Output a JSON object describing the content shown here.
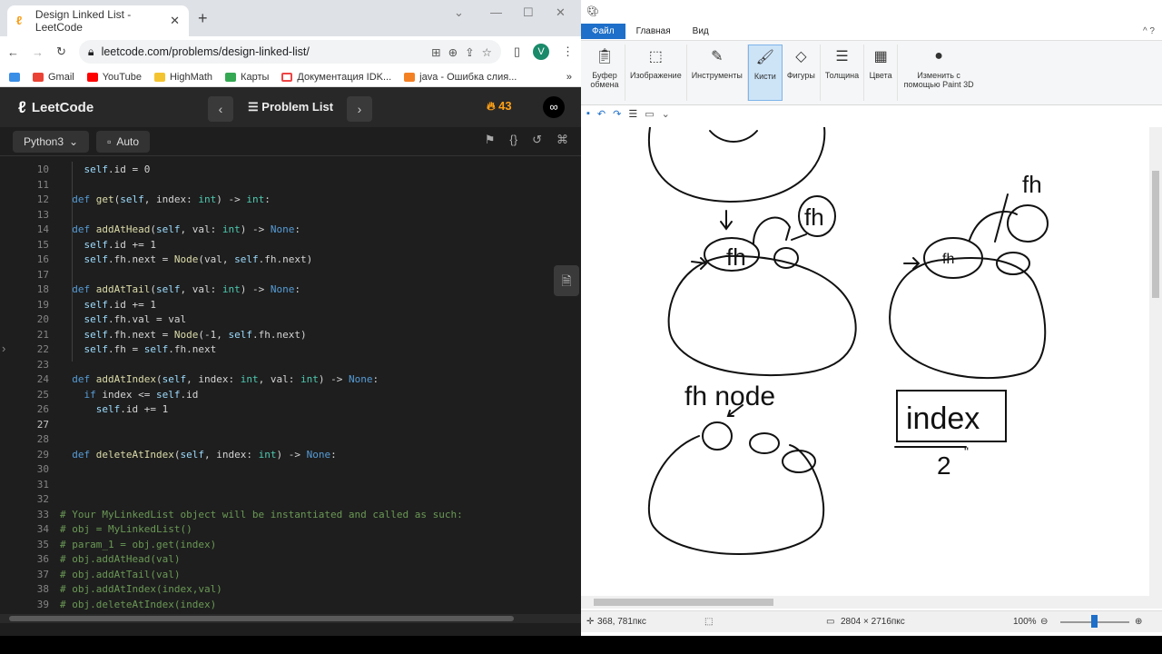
{
  "browser": {
    "tab_title": "Design Linked List - LeetCode",
    "url": "leetcode.com/problems/design-linked-list/",
    "profile_initial": "V",
    "bookmarks": [
      "Gmail",
      "YouTube",
      "HighMath",
      "Карты",
      "Документация IDK...",
      "java - Ошибка слия..."
    ]
  },
  "leetcode": {
    "logo": "LeetCode",
    "problem_list": "Problem List",
    "streak": "43",
    "language": "Python3",
    "mode": "Auto"
  },
  "code_lines": [
    {
      "n": "10",
      "text": "    self.id = 0"
    },
    {
      "n": "11",
      "text": ""
    },
    {
      "n": "12",
      "text": "  def get(self, index: int) -> int:"
    },
    {
      "n": "13",
      "text": ""
    },
    {
      "n": "14",
      "text": "  def addAtHead(self, val: int) -> None:"
    },
    {
      "n": "15",
      "text": "    self.id += 1"
    },
    {
      "n": "16",
      "text": "    self.fh.next = Node(val, self.fh.next)"
    },
    {
      "n": "17",
      "text": ""
    },
    {
      "n": "18",
      "text": "  def addAtTail(self, val: int) -> None:"
    },
    {
      "n": "19",
      "text": "    self.id += 1"
    },
    {
      "n": "20",
      "text": "    self.fh.val = val"
    },
    {
      "n": "21",
      "text": "    self.fh.next = Node(-1, self.fh.next)"
    },
    {
      "n": "22",
      "text": "    self.fh = self.fh.next"
    },
    {
      "n": "23",
      "text": ""
    },
    {
      "n": "24",
      "text": "  def addAtIndex(self, index: int, val: int) -> None:"
    },
    {
      "n": "25",
      "text": "    if index <= self.id"
    },
    {
      "n": "26",
      "text": "      self.id += 1"
    },
    {
      "n": "27",
      "text": ""
    },
    {
      "n": "28",
      "text": ""
    },
    {
      "n": "29",
      "text": "  def deleteAtIndex(self, index: int) -> None:"
    },
    {
      "n": "30",
      "text": ""
    },
    {
      "n": "31",
      "text": ""
    },
    {
      "n": "32",
      "text": ""
    },
    {
      "n": "33",
      "text": "# Your MyLinkedList object will be instantiated and called as such:"
    },
    {
      "n": "34",
      "text": "# obj = MyLinkedList()"
    },
    {
      "n": "35",
      "text": "# param_1 = obj.get(index)"
    },
    {
      "n": "36",
      "text": "# obj.addAtHead(val)"
    },
    {
      "n": "37",
      "text": "# obj.addAtTail(val)"
    },
    {
      "n": "38",
      "text": "# obj.addAtIndex(index,val)"
    },
    {
      "n": "39",
      "text": "# obj.deleteAtIndex(index)"
    }
  ],
  "paint": {
    "tabs": [
      "Файл",
      "Главная",
      "Вид"
    ],
    "ribbon": {
      "clipboard": "Буфер обмена",
      "image": "Изображение",
      "tools": "Инструменты",
      "brushes": "Кисти",
      "shapes": "Фигуры",
      "size": "Толщина",
      "colors": "Цвета",
      "paint3d": "Изменить с помощью Paint 3D"
    },
    "sketch_text": {
      "fh1": "fh",
      "fh2": "fh",
      "fh3": "fh",
      "fh4": "fh",
      "node": "fh node",
      "index": "index",
      "two": "2",
      "quote": "\""
    },
    "status": {
      "cursor": "368, 781пкс",
      "size": "2804 × 2716пкс",
      "zoom": "100%"
    }
  }
}
